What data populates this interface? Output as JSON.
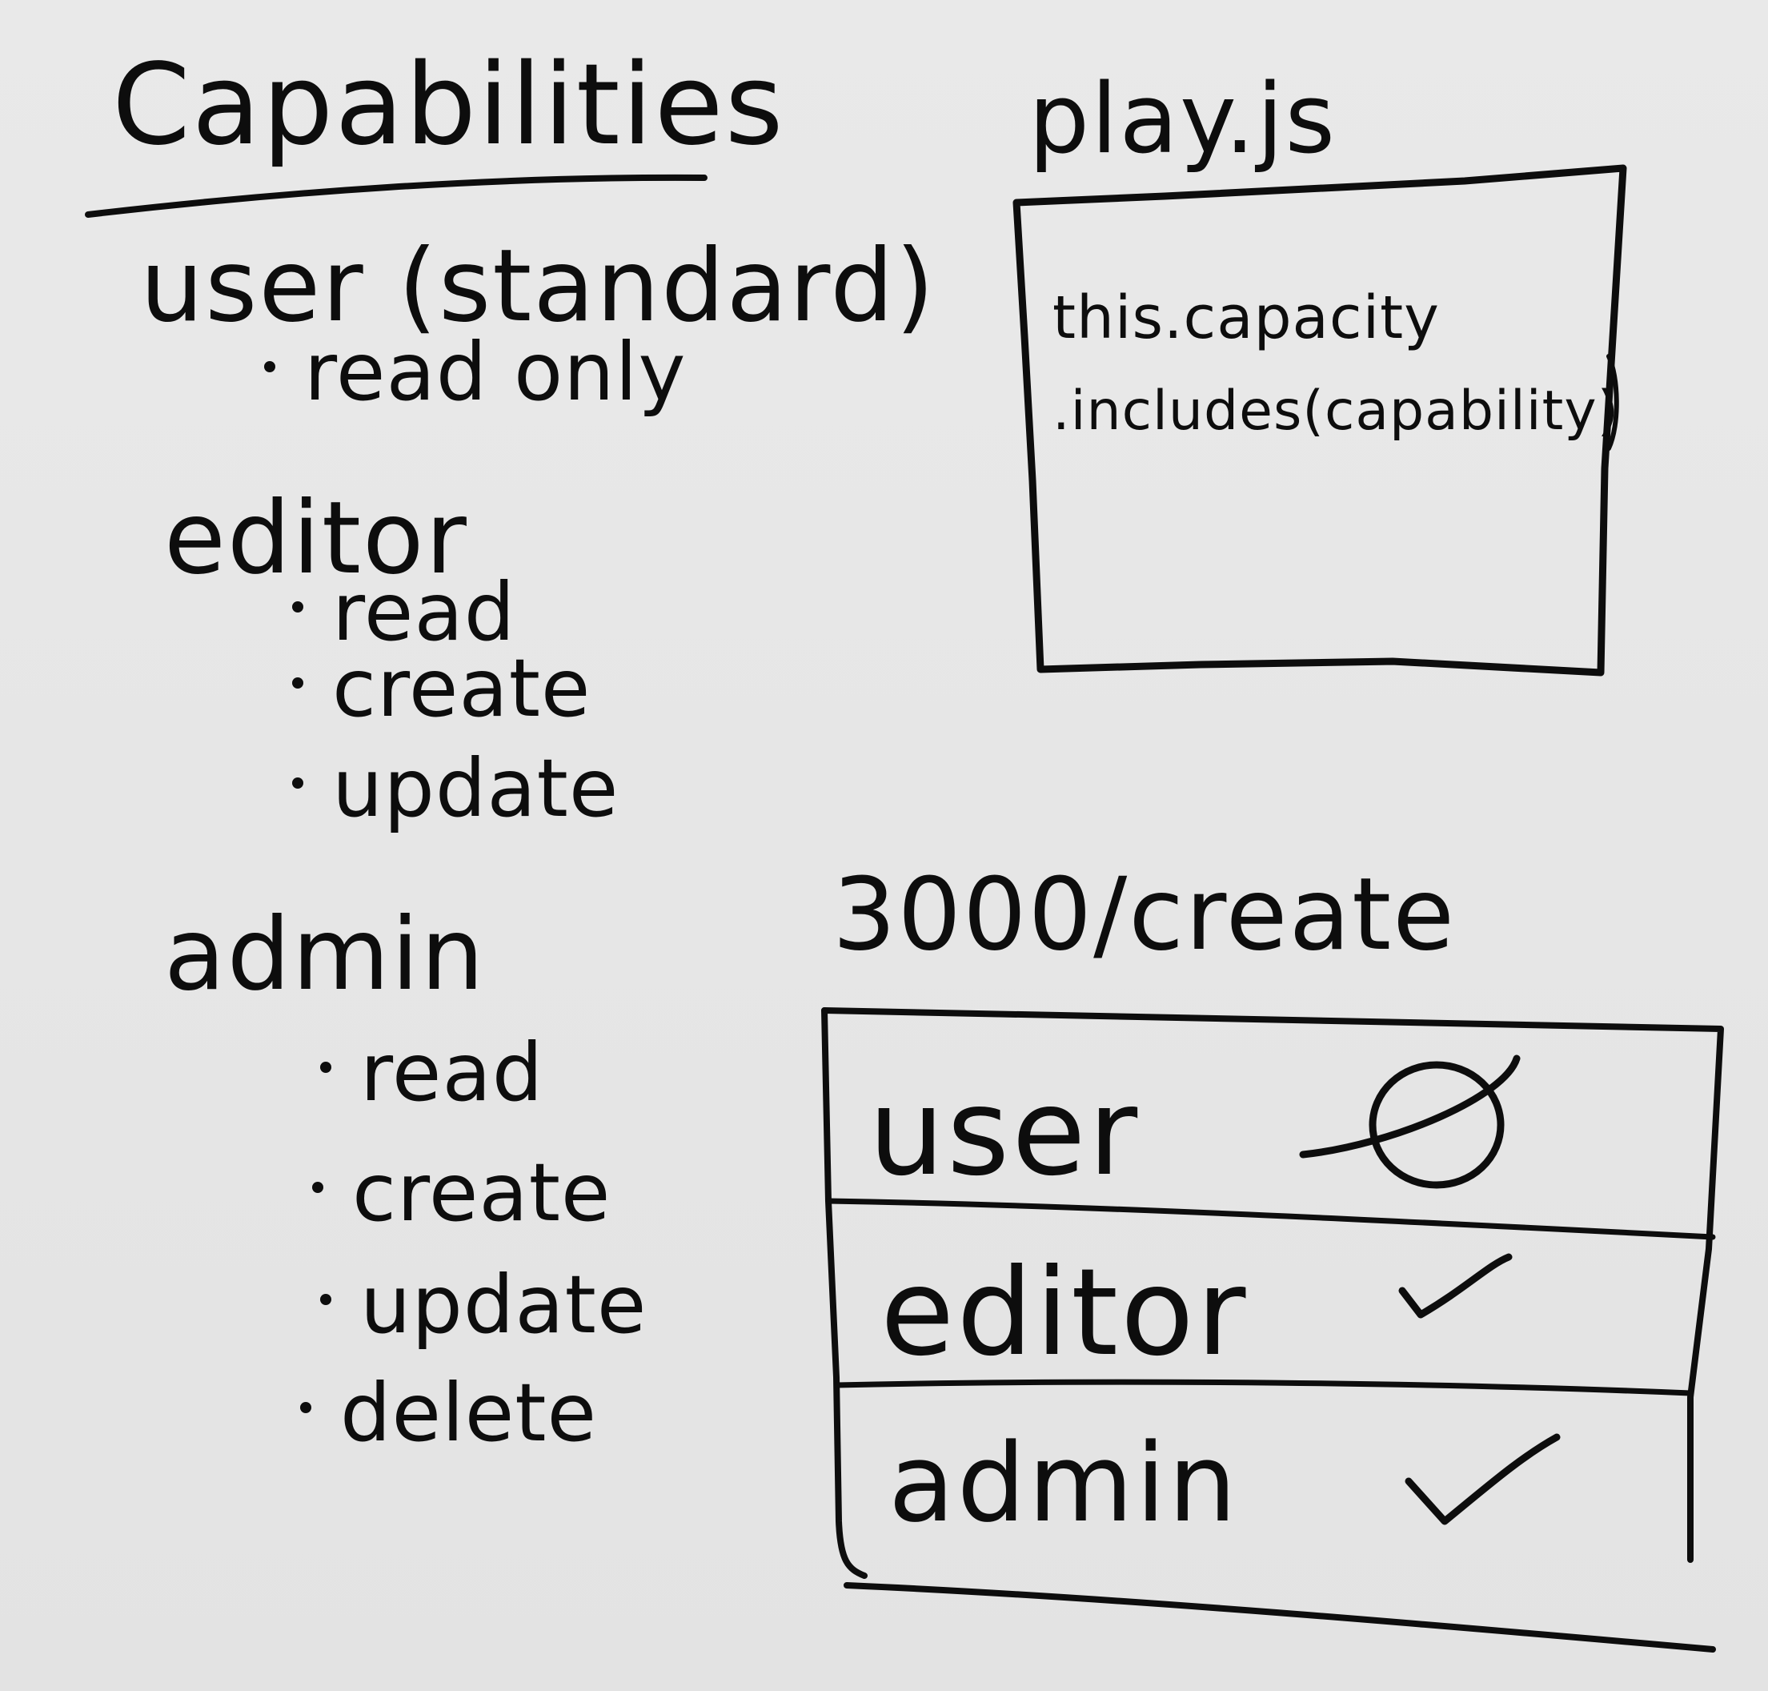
{
  "capabilities": {
    "title": "Capabilities",
    "roles": [
      {
        "name": "user (standard)",
        "items": [
          "read only"
        ]
      },
      {
        "name": "editor",
        "items": [
          "read",
          "create",
          "update"
        ]
      },
      {
        "name": "admin",
        "items": [
          "read",
          "create",
          "update",
          "delete"
        ]
      }
    ]
  },
  "play_js": {
    "title": "play.js",
    "code_lines": [
      "this.capacity",
      ".includes(capability)"
    ]
  },
  "endpoint": {
    "title": "3000/create",
    "rows": [
      {
        "role": "user",
        "mark": "Ø",
        "mark_icon": "null-circle-icon",
        "allowed": false
      },
      {
        "role": "editor",
        "mark": "✓",
        "mark_icon": "checkmark-icon",
        "allowed": true
      },
      {
        "role": "admin",
        "mark": "✓",
        "mark_icon": "checkmark-icon",
        "allowed": true
      }
    ]
  }
}
